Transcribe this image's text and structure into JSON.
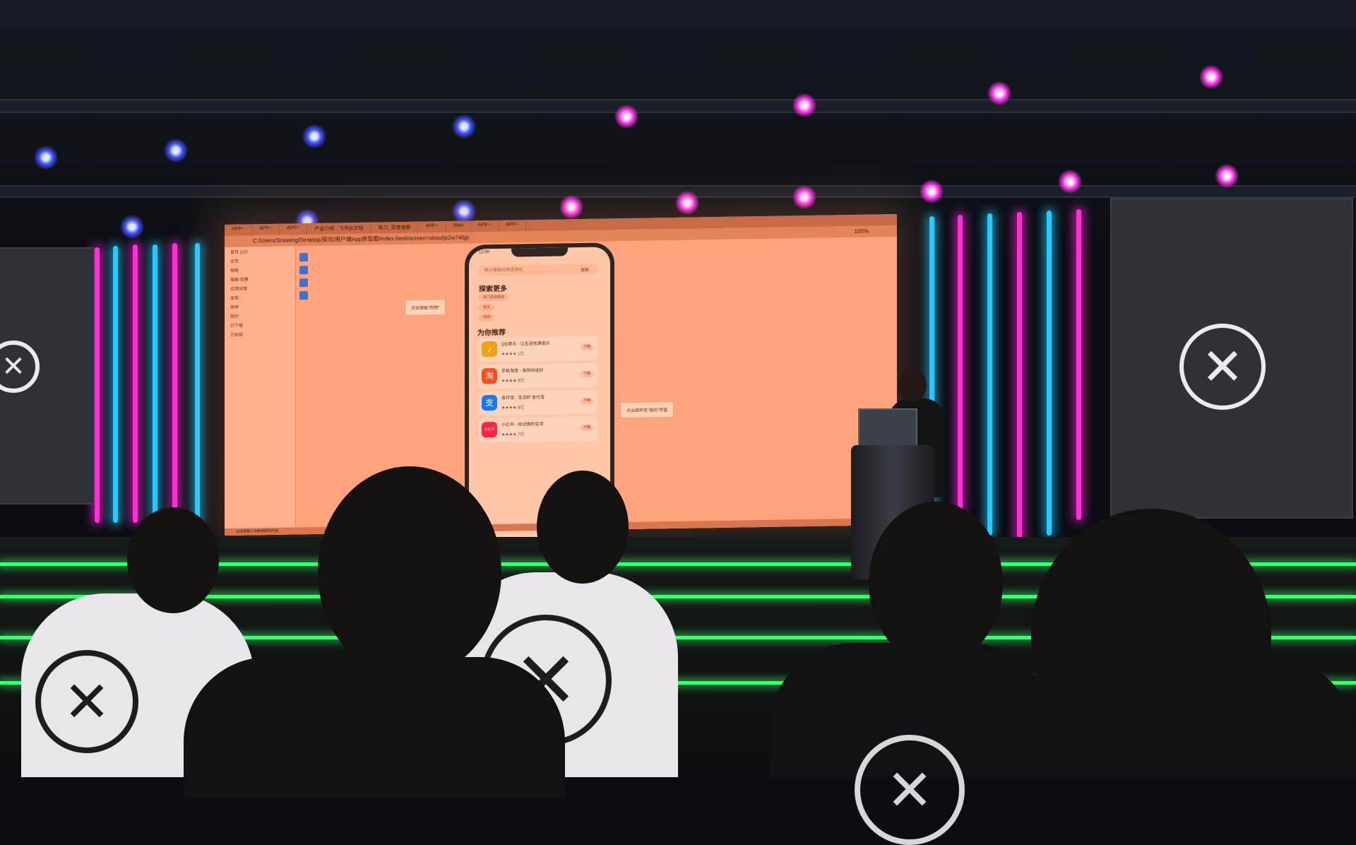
{
  "scene": {
    "type": "photo",
    "colors": {
      "accent_magenta": "#ff2fd8",
      "accent_cyan": "#28c9ff",
      "stage_green": "#3bff72",
      "screen_orange": "#fba277"
    }
  },
  "projection": {
    "tabs": [
      "APP~",
      "APP~",
      "APP~",
      "产品介绍 · 飞书云文档",
      "新刀_百度搜索",
      "APP~",
      "Web",
      "APP~",
      "APP~"
    ],
    "address": "C:/Users/Snowing/Desktop/探究/用户端App原型图/index.html#screen=skou0p2w746jjc",
    "zoom": "100%",
    "tree_items": [
      "首页 (10)",
      "主页",
      "搜索",
      "搜索-结果",
      "应用详情",
      "发现",
      "榜单",
      "我的",
      "已下载",
      "已安装"
    ],
    "phone": {
      "time": "12:00",
      "search_placeholder": "输入搜索应用或游戏",
      "search_button": "搜索",
      "section_explore": "探索更多",
      "tags": [
        "热门游戏精选",
        "音乐",
        "视频"
      ],
      "section_recommend": "为你推荐",
      "apps": [
        {
          "name": "QQ音乐 - 让生活充满音乐",
          "rating": "★★★★ 1亿",
          "button": "下载",
          "color": "#f0a016",
          "glyph": "♪"
        },
        {
          "name": "手机淘宝 - 淘到你说好",
          "rating": "★★★★ 9亿",
          "button": "下载",
          "color": "#ff4d1a",
          "glyph": "淘"
        },
        {
          "name": "支付宝 - 生活好 支付宝",
          "rating": "★★★★ 8亿",
          "button": "下载",
          "color": "#1677ff",
          "glyph": "支"
        },
        {
          "name": "小红书 - 标记我的生活",
          "rating": "★★★★ 7亿",
          "button": "下载",
          "color": "#ff2442",
          "glyph": "小红书"
        }
      ]
    },
    "notes": [
      "点击搜索\"构物\"",
      "点击跳转至\"我的\"界面"
    ],
    "taskbar_search": "在这里输入你要搜索的内容"
  },
  "branding": {
    "logo_glyph": "✕"
  }
}
